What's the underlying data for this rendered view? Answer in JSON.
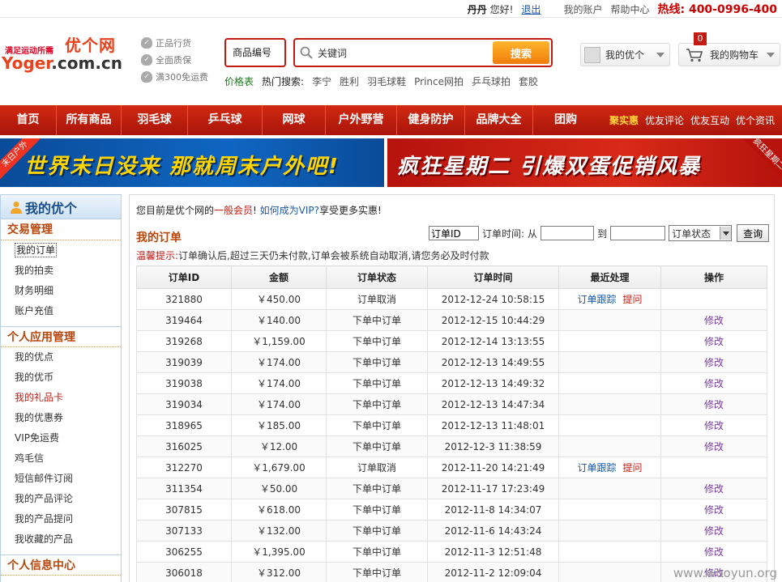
{
  "topbar": {
    "user": "丹丹",
    "greeting": "您好!",
    "logout": "退出",
    "my_account": "我的账户",
    "help": "帮助中心",
    "hotline_label": "热线:",
    "hotline": "400-0996-400"
  },
  "logo": {
    "slogan": "满足运动所需",
    "cn": "优个网",
    "en_a": "Yoger",
    "en_b": ".com.cn"
  },
  "badges": [
    "正品行货",
    "全面质保",
    "满300免运费"
  ],
  "search": {
    "category": "商品编号",
    "placeholder": "关键词",
    "button": "搜索"
  },
  "hot": {
    "price_table": "价格表",
    "label": "热门搜索:",
    "keywords": [
      "李宁",
      "胜利",
      "羽毛球鞋",
      "Prince网拍",
      "乒乓球拍",
      "套胶"
    ]
  },
  "header_buttons": {
    "my_youge": "我的优个",
    "cart": "我的购物车",
    "cart_count": "0"
  },
  "nav": {
    "items": [
      "首页",
      "所有商品",
      "羽毛球",
      "乒乓球",
      "网球",
      "户外野营",
      "健身防护",
      "品牌大全",
      "团购"
    ],
    "sub": [
      "聚实惠",
      "优友评论",
      "优友互动",
      "优个资讯"
    ]
  },
  "banners": {
    "left": "世界末日没来 那就周末户外吧!",
    "left_ribbon": "末日户外",
    "right": "疯狂星期二 引爆双蛋促销风暴",
    "right_ribbon": "疯狂星期二"
  },
  "sidebar": {
    "title": "我的优个",
    "sections": [
      {
        "name": "交易管理",
        "items": [
          "我的订单",
          "我的拍卖",
          "财务明细",
          "账户充值"
        ]
      },
      {
        "name": "个人应用管理",
        "items": [
          "我的优点",
          "我的优币",
          "我的礼品卡",
          "我的优惠券",
          "VIP免运费",
          "鸡毛信",
          "短信邮件订阅",
          "我的产品评论",
          "我的产品提问",
          "我收藏的产品"
        ]
      },
      {
        "name": "个人信息中心",
        "items": []
      }
    ]
  },
  "main": {
    "notice_a": "您目前是优个网的",
    "level": "一般会员",
    "notice_b": "! ",
    "vip_link": "如何成为VIP?",
    "notice_c": "享受更多实惠!",
    "title": "我的订单",
    "filter": {
      "order_id_value": "订单ID",
      "time_label": "订单时间:",
      "from": "从",
      "to": "到",
      "status": "订单状态",
      "query": "查询"
    },
    "tip_label": "温馨提示:",
    "tip": "订单确认后,超过三天仍未付款,订单会被系统自动取消,请您务必及时付款",
    "columns": [
      "订单ID",
      "金额",
      "订单状态",
      "订单时间",
      "最近处理",
      "操作"
    ],
    "rows": [
      {
        "id": "321880",
        "amount": "￥450.00",
        "status": "订单取消",
        "time": "2012-12-24 10:58:15",
        "track": "订单跟踪",
        "remind": "提问",
        "op": ""
      },
      {
        "id": "319464",
        "amount": "￥140.00",
        "status": "下单中订单",
        "time": "2012-12-15 10:44:29",
        "track": "",
        "remind": "",
        "op": "修改"
      },
      {
        "id": "319268",
        "amount": "￥1,159.00",
        "status": "下单中订单",
        "time": "2012-12-14 13:13:55",
        "track": "",
        "remind": "",
        "op": "修改"
      },
      {
        "id": "319039",
        "amount": "￥174.00",
        "status": "下单中订单",
        "time": "2012-12-13 14:49:55",
        "track": "",
        "remind": "",
        "op": "修改"
      },
      {
        "id": "319038",
        "amount": "￥174.00",
        "status": "下单中订单",
        "time": "2012-12-13 14:49:32",
        "track": "",
        "remind": "",
        "op": "修改"
      },
      {
        "id": "319034",
        "amount": "￥174.00",
        "status": "下单中订单",
        "time": "2012-12-13 14:47:34",
        "track": "",
        "remind": "",
        "op": "修改"
      },
      {
        "id": "318965",
        "amount": "￥185.00",
        "status": "下单中订单",
        "time": "2012-12-13 11:48:01",
        "track": "",
        "remind": "",
        "op": "修改"
      },
      {
        "id": "316025",
        "amount": "￥12.00",
        "status": "下单中订单",
        "time": "2012-12-3 11:38:59",
        "track": "",
        "remind": "",
        "op": "修改"
      },
      {
        "id": "312270",
        "amount": "￥1,679.00",
        "status": "订单取消",
        "time": "2012-11-20 14:21:49",
        "track": "订单跟踪",
        "remind": "提问",
        "op": ""
      },
      {
        "id": "311354",
        "amount": "￥50.00",
        "status": "下单中订单",
        "time": "2012-11-17 17:23:49",
        "track": "",
        "remind": "",
        "op": "修改"
      },
      {
        "id": "307815",
        "amount": "￥618.00",
        "status": "下单中订单",
        "time": "2012-11-8 14:34:07",
        "track": "",
        "remind": "",
        "op": "修改"
      },
      {
        "id": "307133",
        "amount": "￥132.00",
        "status": "下单中订单",
        "time": "2012-11-6 14:43:24",
        "track": "",
        "remind": "",
        "op": "修改"
      },
      {
        "id": "306255",
        "amount": "￥1,395.00",
        "status": "下单中订单",
        "time": "2012-11-3 12:51:48",
        "track": "",
        "remind": "",
        "op": "修改"
      },
      {
        "id": "306018",
        "amount": "￥312.00",
        "status": "下单中订单",
        "time": "2012-11-2 12:09:04",
        "track": "",
        "remind": "",
        "op": "修改"
      }
    ]
  },
  "watermark": "www.wooyun.org"
}
